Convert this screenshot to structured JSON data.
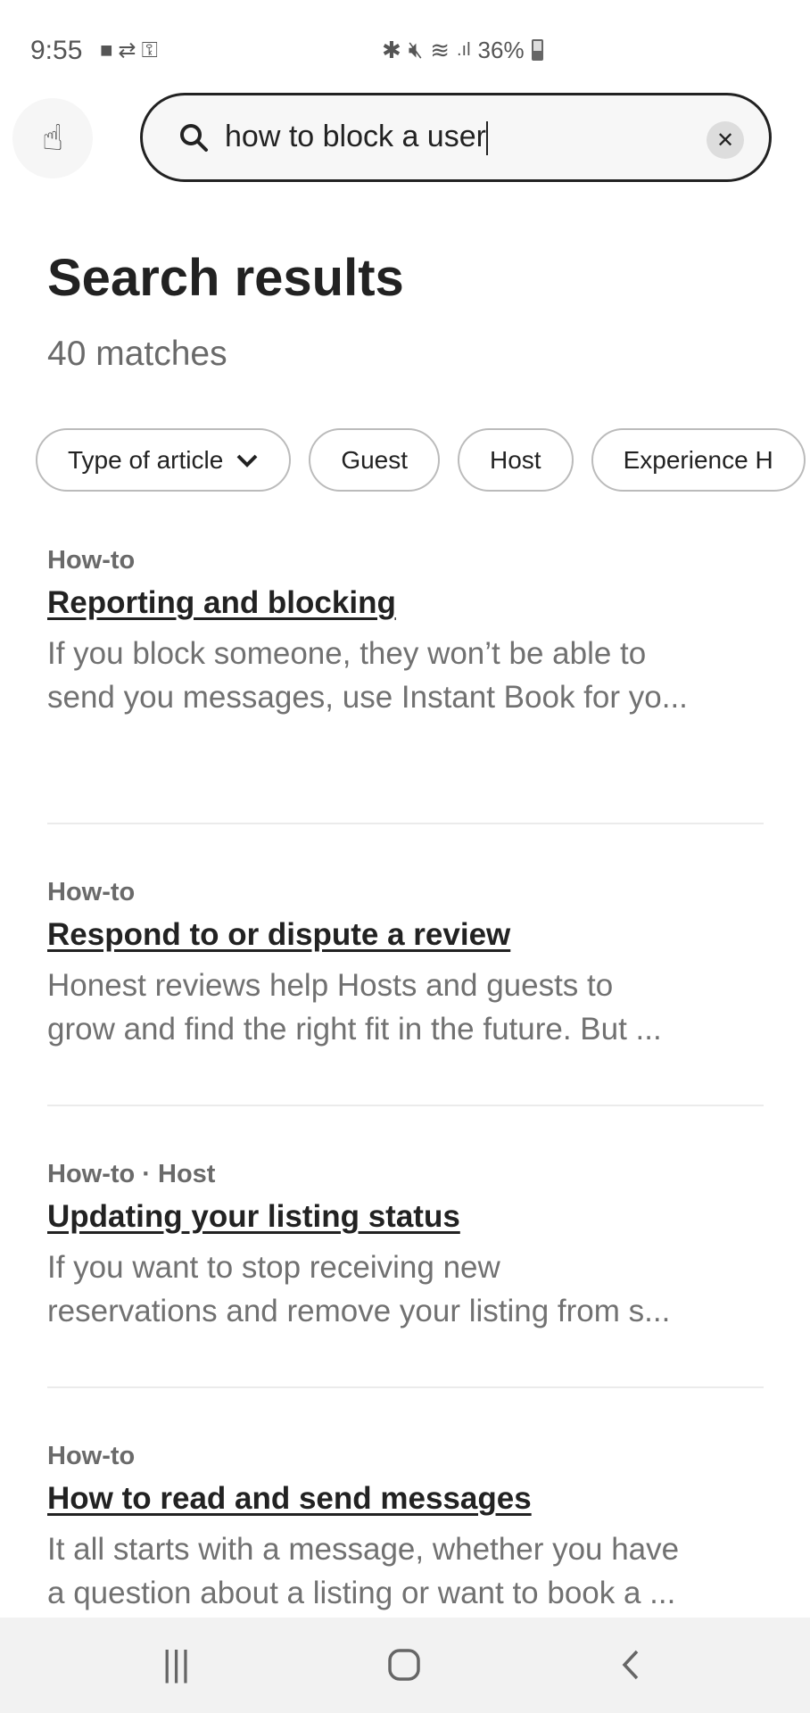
{
  "status_bar": {
    "time": "9:55",
    "battery": "36%",
    "left_icons": [
      "video-icon",
      "sync-icon",
      "vpn-key-icon"
    ],
    "right_icons": [
      "bluetooth-icon",
      "mute-icon",
      "wifi-icon",
      "signal-icon",
      "battery-icon"
    ]
  },
  "search": {
    "query": "how to block a user",
    "clear_icon": "close-icon"
  },
  "header": {
    "title": "Search results",
    "matches": "40 matches"
  },
  "filters": [
    {
      "label": "Type of article",
      "has_dropdown": true
    },
    {
      "label": "Guest"
    },
    {
      "label": "Host"
    },
    {
      "label": "Experience H"
    }
  ],
  "results": [
    {
      "category": "How-to",
      "title": "Reporting and blocking",
      "line1": "If you block someone, they won’t be able to",
      "line2": "send you messages, use Instant Book for yo..."
    },
    {
      "category": "How-to",
      "title": "Respond to or dispute a review",
      "line1": "Honest reviews help Hosts and guests to",
      "line2": "grow and find the right fit in the future. But ..."
    },
    {
      "category": "How-to · Host",
      "title": "Updating your listing status",
      "line1": "If you want to stop receiving new",
      "line2": "reservations and remove your listing from s..."
    },
    {
      "category": "How-to",
      "title": "How to read and send messages",
      "line1": "It all starts with a message, whether you have",
      "line2": "a question about a listing or want to book a ..."
    }
  ],
  "navbar": {
    "icons": [
      "recent-apps-icon",
      "home-icon",
      "back-icon"
    ]
  }
}
